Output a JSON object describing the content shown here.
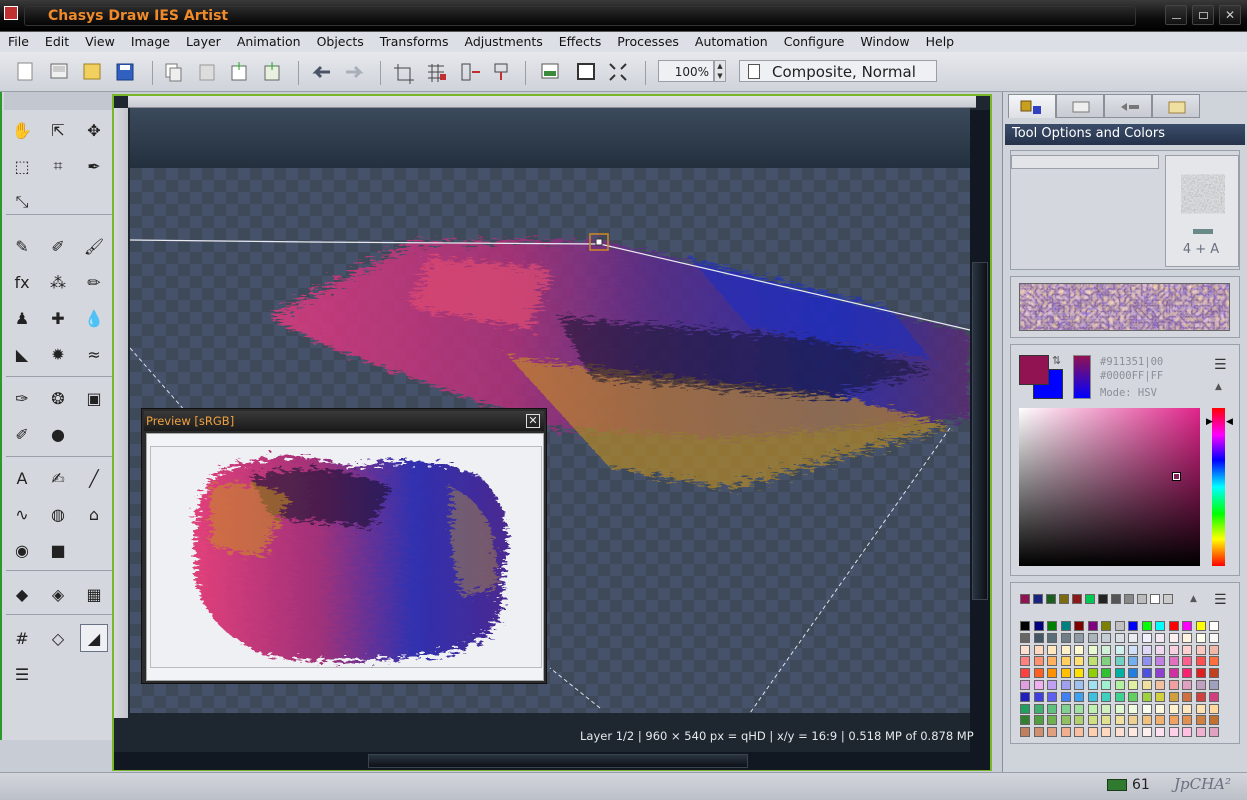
{
  "window": {
    "title": "Chasys Draw IES Artist"
  },
  "menu": [
    "File",
    "Edit",
    "View",
    "Image",
    "Layer",
    "Animation",
    "Objects",
    "Transforms",
    "Adjustments",
    "Effects",
    "Processes",
    "Automation",
    "Configure",
    "Window",
    "Help"
  ],
  "toolbar": {
    "zoom": "100%",
    "blend_mode": "Composite, Normal",
    "icons": [
      "new-icon",
      "open-icon",
      "browse-icon",
      "save-icon",
      "copy-icon",
      "paste-icon",
      "new-layer-icon",
      "add-layer-icon",
      "undo-icon",
      "redo-icon",
      "crop-icon",
      "grid-icon",
      "flip-icon",
      "move-icon",
      "image-icon",
      "frame-icon",
      "fullscreen-icon"
    ]
  },
  "tools": {
    "rows": [
      [
        "hand-icon",
        "pointer-icon",
        "move-icon"
      ],
      [
        "select-icon",
        "crop-icon",
        "eyedropper-icon"
      ],
      [
        "resize-icon"
      ],
      [
        "pencil-icon",
        "pen-icon",
        "brush-icon"
      ],
      [
        "fx-icon",
        "clone-icon",
        "pipette-icon"
      ],
      [
        "stamp-icon",
        "bandage-icon",
        "drop-icon"
      ],
      [
        "cone-icon",
        "splat-icon",
        "wave-icon"
      ],
      [
        "marker-icon",
        "palette-icon",
        "picture-icon"
      ],
      [
        "pen-blue-icon",
        "sphere-icon"
      ],
      [
        "text-icon",
        "calligraphy-icon",
        "line-icon"
      ],
      [
        "curve-icon",
        "shape-icon",
        "warp-icon"
      ],
      [
        "cylinder-icon",
        "cube-icon"
      ],
      [
        "fill-icon",
        "bucket-icon",
        "gradient-icon"
      ],
      [
        "grid-warp-icon",
        "perspective-icon",
        "eraser-icon"
      ],
      [
        "sliders-icon"
      ]
    ],
    "glyphs": [
      "✋",
      "⇱",
      "✥",
      "⬚",
      "⌗",
      "✒",
      "⤡",
      "✎",
      "✐",
      "🖌",
      "fx",
      "⁂",
      "✏",
      "♟",
      "✚",
      "💧",
      "◣",
      "✹",
      "≈",
      "✑",
      "❂",
      "▣",
      "✐",
      "●",
      "A",
      "✍",
      "╱",
      "∿",
      "◍",
      "⌂",
      "◉",
      "■",
      "◆",
      "◈",
      "▦",
      "#",
      "◇",
      "◢",
      "☰"
    ]
  },
  "preview": {
    "title": "Preview [sRGB]",
    "close": "✕"
  },
  "status": {
    "document": "Layer 1/2 | 960 × 540 px = qHD | x/y = 16:9 | 0.518 MP of 0.878 MP",
    "ram": "61",
    "brand": "JpCHA²"
  },
  "panel": {
    "header": "Tool Options and Colors",
    "brush_label": "4 + A",
    "primary_color": "#911351|00",
    "secondary_color": "#0000FF|FF",
    "mode": "Mode: HSV",
    "primary_hex": "#911351",
    "secondary_hex": "#0000FF"
  },
  "palette": {
    "recent": [
      "#911351",
      "#1a237e",
      "#1b5e20",
      "#7b6a12",
      "#8a1a1a",
      "#00c853",
      "#222222",
      "#555555",
      "#888888",
      "#bbbbbb",
      "#ffffff",
      "#cccccc"
    ],
    "grid": [
      [
        "#000000",
        "#000080",
        "#008000",
        "#008080",
        "#800000",
        "#800080",
        "#808000",
        "#c0c0c0",
        "#0000ff",
        "#00ff00",
        "#00ffff",
        "#ff0000",
        "#ff00ff",
        "#ffff00",
        "#ffffff"
      ],
      [
        "#666666",
        "#445566",
        "#5a6e7a",
        "#707e88",
        "#8e9aa4",
        "#aab4bc",
        "#c4ccd4",
        "#d8dee4",
        "#e8ecf0",
        "#f0f0ff",
        "#f4e8f4",
        "#fff0f0",
        "#fff4e0",
        "#fffff0",
        "#f8f8f8"
      ],
      [
        "#ffe0d0",
        "#ffd8c0",
        "#ffe8c0",
        "#fff0c8",
        "#fff8d0",
        "#e8f8d0",
        "#d0f0d8",
        "#d0f0f0",
        "#d0e0f8",
        "#e0d8f8",
        "#f0d8f0",
        "#f8d0e0",
        "#ffd0d0",
        "#f8c8c0",
        "#f0b8a8"
      ],
      [
        "#ff8080",
        "#ff9070",
        "#ffb060",
        "#ffd060",
        "#ffe070",
        "#c0e070",
        "#80d080",
        "#70d0c0",
        "#70b0f0",
        "#9090f0",
        "#c080e0",
        "#e070c0",
        "#ff6090",
        "#ff5050",
        "#ff7040"
      ],
      [
        "#ff4040",
        "#ff6020",
        "#ff9000",
        "#ffc000",
        "#ffe000",
        "#90d000",
        "#30c030",
        "#00b0a0",
        "#2080e0",
        "#5050e0",
        "#9040d0",
        "#d030a0",
        "#ff2070",
        "#e02020",
        "#c04020"
      ],
      [
        "#e0a0e0",
        "#f0b0f0",
        "#c0a0f0",
        "#a0a0f0",
        "#a0c0f0",
        "#a0e0f0",
        "#a0f0d0",
        "#b0f0a0",
        "#e0f0a0",
        "#f0e0a0",
        "#f0c0a0",
        "#f0a0a0",
        "#e0a0c0",
        "#c0a0c0",
        "#a0a0c0"
      ],
      [
        "#2020c0",
        "#4040e0",
        "#6060f0",
        "#4080f0",
        "#40a0f0",
        "#40c0e0",
        "#40d0c0",
        "#40d090",
        "#60d060",
        "#a0d040",
        "#d0d040",
        "#d0a040",
        "#d07040",
        "#d04040",
        "#d04080"
      ],
      [
        "#20a060",
        "#40b070",
        "#60c080",
        "#80d090",
        "#a0e0a0",
        "#c0f0b0",
        "#d0f0c0",
        "#e0f8d0",
        "#f0fce0",
        "#f8fff0",
        "#fff8e0",
        "#fff0d0",
        "#ffe8c0",
        "#ffe0b0",
        "#ffd8a0"
      ],
      [
        "#308030",
        "#50a040",
        "#70b050",
        "#90c060",
        "#b0d070",
        "#d0e080",
        "#e0e090",
        "#f0e0a0",
        "#f0d090",
        "#f0c080",
        "#f0b070",
        "#f0a060",
        "#e09050",
        "#d08040",
        "#c07030"
      ],
      [
        "#c08060",
        "#d09070",
        "#e0a080",
        "#f0b090",
        "#f8c0a0",
        "#ffd0b0",
        "#ffd8c0",
        "#ffe0d0",
        "#ffe8e0",
        "#fff0f0",
        "#ffe0f0",
        "#ffd0e8",
        "#ffc0e0",
        "#f0b0d0",
        "#e0a0c0"
      ]
    ]
  },
  "colors": {
    "accent_green": "#78b828",
    "title_orange": "#f08a2a",
    "panel_header": "#3c4d6a"
  }
}
